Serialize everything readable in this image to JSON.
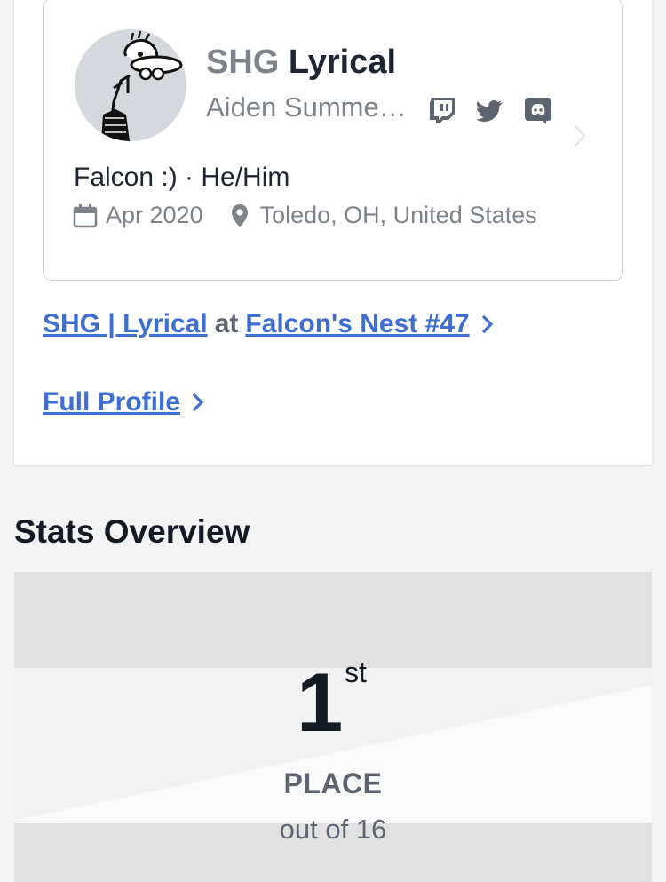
{
  "profile": {
    "prefix": "SHG",
    "gamertag": "Lyrical",
    "real_name": "Aiden Summe…",
    "social_icons": [
      "twitch-icon",
      "twitter-icon",
      "discord-icon"
    ],
    "bio": "Falcon :) · He/Him",
    "joined": "Apr 2020",
    "location": "Toledo, OH, United States"
  },
  "links": {
    "entrant_name": "SHG | Lyrical",
    "at_word": "at",
    "event_name": "Falcon's Nest #47",
    "full_profile": "Full Profile"
  },
  "stats": {
    "title": "Stats Overview",
    "place_number": "1",
    "place_suffix": "st",
    "place_label": "PLACE",
    "place_total": "out of 16"
  },
  "colors": {
    "link": "#3d6ed0",
    "muted_text": "#7d8389",
    "dark_text": "#1f2533"
  }
}
